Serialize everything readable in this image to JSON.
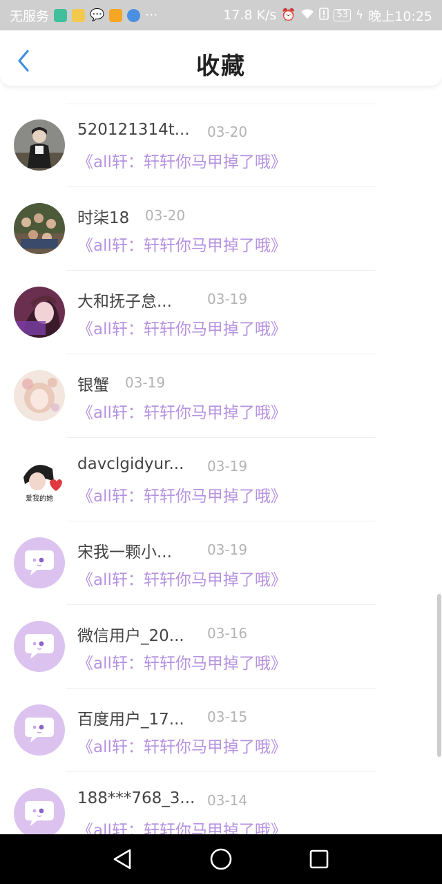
{
  "status_bar": {
    "carrier": "无服务",
    "more": "···",
    "speed": "17.8 K/s",
    "battery": "53",
    "time": "晚上10:25"
  },
  "header": {
    "title": "收藏",
    "back_icon": "chevron-left-icon"
  },
  "colors": {
    "accent": "#b692e0",
    "default_avatar": "#dcc3ef"
  },
  "items": [
    {
      "name": "520121314t...",
      "date": "03-20",
      "title": "《all轩：轩轩你马甲掉了哦》",
      "avatar": "photo-dark"
    },
    {
      "name": "时柒18",
      "date": "03-20",
      "title": "《all轩：轩轩你马甲掉了哦》",
      "avatar": "photo-group"
    },
    {
      "name": "大和抚子怠...",
      "date": "03-19",
      "title": "《all轩：轩轩你马甲掉了哦》",
      "avatar": "photo-purple"
    },
    {
      "name": "银蟹",
      "date": "03-19",
      "title": "《all轩：轩轩你马甲掉了哦》",
      "avatar": "photo-illustration"
    },
    {
      "name": "davclgidyur...",
      "date": "03-19",
      "title": "《all轩：轩轩你马甲掉了哦》",
      "avatar": "photo-cartoon"
    },
    {
      "name": "宋我一颗小...",
      "date": "03-19",
      "title": "《all轩：轩轩你马甲掉了哦》",
      "avatar": "default"
    },
    {
      "name": "微信用户_20...",
      "date": "03-16",
      "title": "《all轩：轩轩你马甲掉了哦》",
      "avatar": "default"
    },
    {
      "name": "百度用户_17...",
      "date": "03-15",
      "title": "《all轩：轩轩你马甲掉了哦》",
      "avatar": "default"
    },
    {
      "name": "188***768_3...",
      "date": "03-14",
      "title": "《all轩：轩轩你马甲掉了哦》",
      "avatar": "default"
    }
  ],
  "avatar_text": {
    "cartoon_caption": "爱我的她"
  }
}
